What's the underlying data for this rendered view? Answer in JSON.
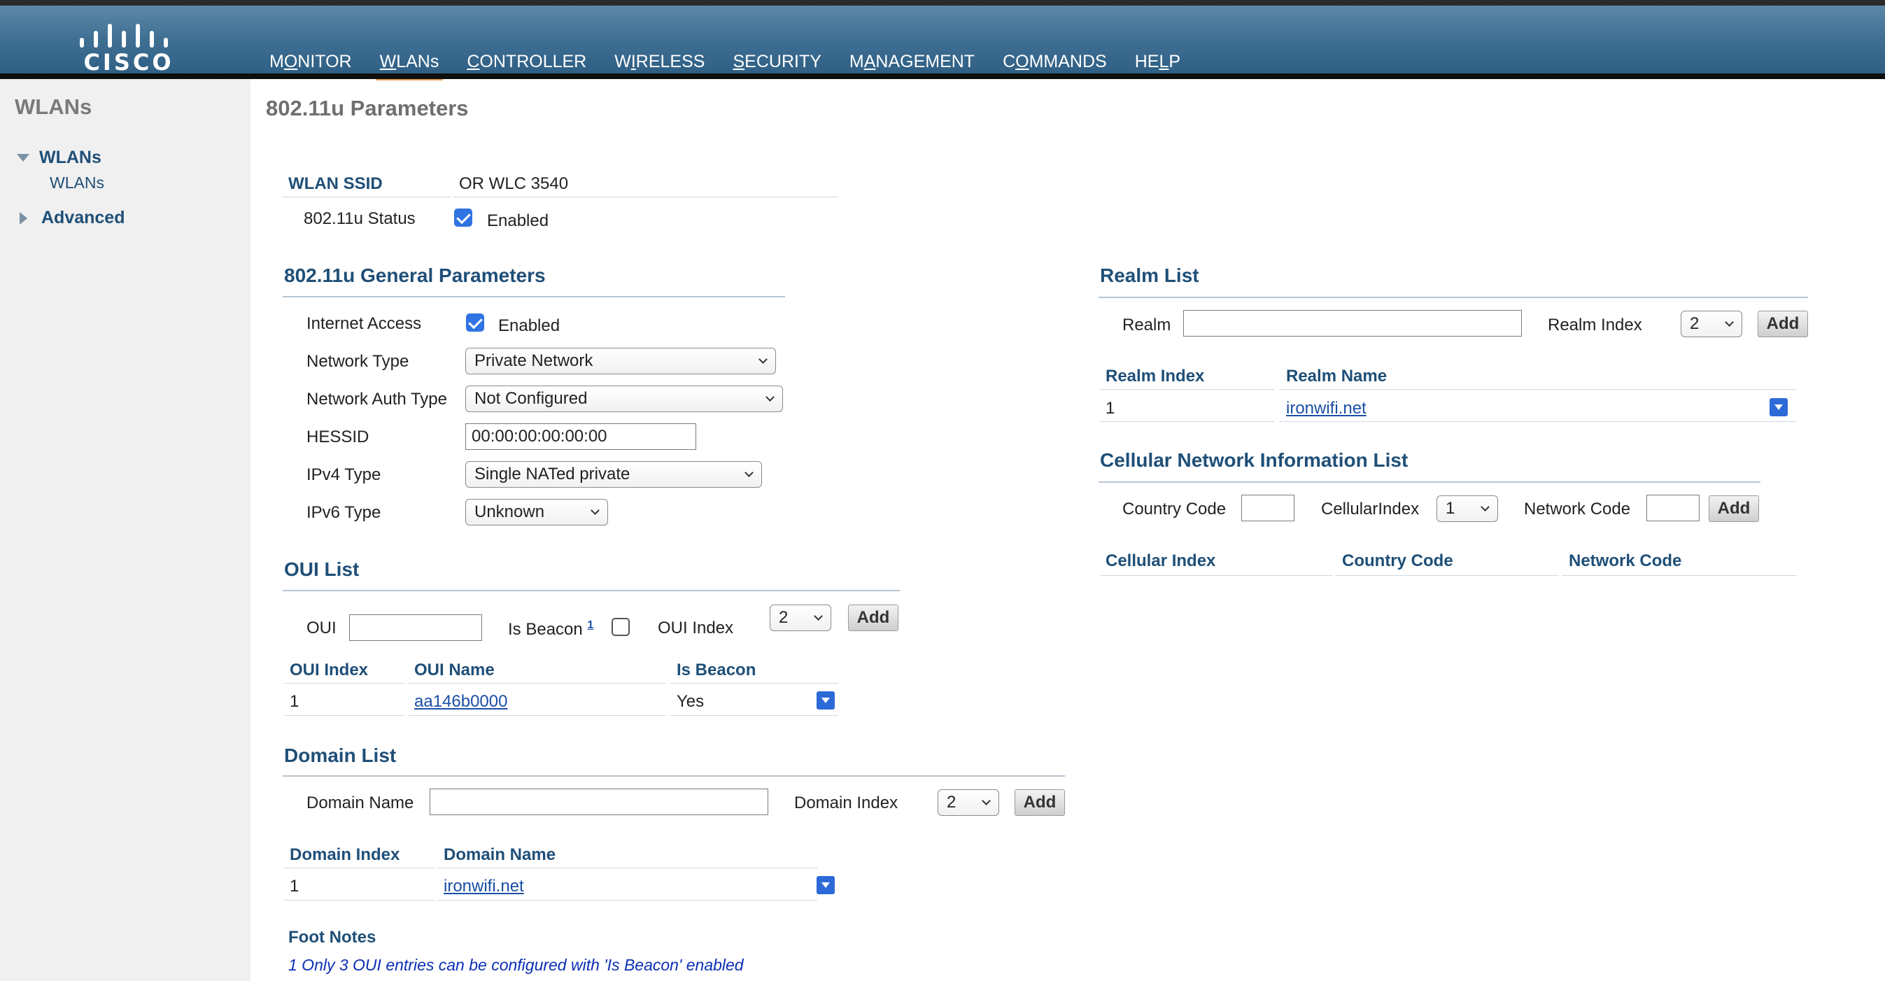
{
  "header": {
    "logo_text": "CISCO",
    "nav": [
      {
        "label": "MONITOR"
      },
      {
        "label": "WLANs"
      },
      {
        "label": "CONTROLLER"
      },
      {
        "label": "WIRELESS"
      },
      {
        "label": "SECURITY"
      },
      {
        "label": "MANAGEMENT"
      },
      {
        "label": "COMMANDS"
      },
      {
        "label": "HELP"
      }
    ],
    "active_nav": "WLANs",
    "accent_color": "#e8a35a"
  },
  "sidebar": {
    "title": "WLANs",
    "groups": [
      {
        "label": "WLANs",
        "expanded": true,
        "items": [
          "WLANs"
        ]
      },
      {
        "label": "Advanced",
        "expanded": false
      }
    ]
  },
  "page": {
    "title": "802.11u Parameters",
    "wlan_ssid_label": "WLAN SSID",
    "wlan_ssid_value": "OR WLC 3540",
    "status_label": "802.11u Status",
    "status_checked": true,
    "status_text": "Enabled"
  },
  "general": {
    "title": "802.11u General Parameters",
    "internet_access_label": "Internet Access",
    "internet_access_checked": true,
    "internet_access_text": "Enabled",
    "network_type_label": "Network Type",
    "network_type_value": "Private Network",
    "network_auth_label": "Network Auth Type",
    "network_auth_value": "Not Configured",
    "hessid_label": "HESSID",
    "hessid_value": "00:00:00:00:00:00",
    "ipv4_label": "IPv4 Type",
    "ipv4_value": "Single NATed private",
    "ipv6_label": "IPv6 Type",
    "ipv6_value": "Unknown"
  },
  "oui": {
    "title": "OUI List",
    "oui_label": "OUI",
    "oui_value": "",
    "is_beacon_label": "Is Beacon",
    "footnote_ref": "1",
    "is_beacon_checked": false,
    "index_label": "OUI Index",
    "index_value": "2",
    "add_label": "Add",
    "columns": [
      "OUI Index",
      "OUI Name",
      "Is Beacon"
    ],
    "rows": [
      {
        "index": "1",
        "name": "aa146b0000",
        "beacon": "Yes"
      }
    ]
  },
  "domain": {
    "title": "Domain List",
    "name_label": "Domain Name",
    "name_value": "",
    "index_label": "Domain Index",
    "index_value": "2",
    "add_label": "Add",
    "columns": [
      "Domain Index",
      "Domain Name"
    ],
    "rows": [
      {
        "index": "1",
        "name": "ironwifi.net"
      }
    ]
  },
  "realm": {
    "title": "Realm List",
    "realm_label": "Realm",
    "realm_value": "",
    "index_label": "Realm Index",
    "index_value": "2",
    "add_label": "Add",
    "columns": [
      "Realm Index",
      "Realm Name"
    ],
    "rows": [
      {
        "index": "1",
        "name": "ironwifi.net"
      }
    ]
  },
  "cellular": {
    "title": "Cellular Network Information List",
    "country_label": "Country Code",
    "country_value": "",
    "cellular_index_label": "CellularIndex",
    "cellular_index_value": "1",
    "network_code_label": "Network Code",
    "network_code_value": "",
    "add_label": "Add",
    "columns": [
      "Cellular Index",
      "Country Code",
      "Network Code"
    ]
  },
  "footnotes": {
    "title": "Foot Notes",
    "note1": "1 Only 3 OUI entries can be configured with 'Is Beacon' enabled"
  },
  "colors": {
    "header_blue": "#3f6f93",
    "label_blue": "#1f4f78",
    "link_blue": "#1a4fa6",
    "checkbox_blue": "#2f74e2",
    "sidebar_bg": "#f0f0f0"
  }
}
